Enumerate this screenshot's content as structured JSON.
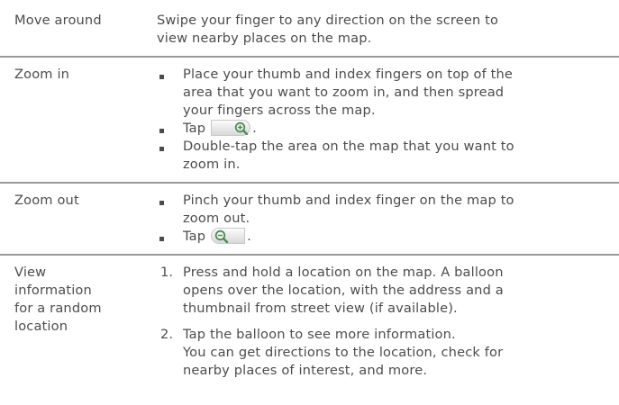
{
  "rows": {
    "move": {
      "label": "Move around",
      "desc": [
        "Swipe your finger to any direction on the screen to",
        "view nearby places on the map."
      ]
    },
    "zoom_in": {
      "label": "Zoom in",
      "bullets": [
        [
          "Place your thumb and index fingers on top of the",
          "area that you want to zoom in, and then spread",
          "your fingers across the map."
        ],
        {
          "before": "Tap",
          "icon": "zoom-in-magnifier-icon",
          "after": "."
        },
        [
          "Double-tap the area on the map that you want to",
          "zoom in."
        ]
      ]
    },
    "zoom_out": {
      "label": "Zoom out",
      "bullets": [
        [
          "Pinch your thumb and index finger on the map to",
          "zoom out."
        ],
        {
          "before": "Tap",
          "icon": "zoom-out-magnifier-icon",
          "after": "."
        }
      ]
    },
    "view_info": {
      "label": [
        "View",
        "information",
        "for a random",
        "location"
      ],
      "steps": [
        {
          "num": "1.",
          "lines": [
            "Press and hold a location on the map. A balloon",
            "opens over the location, with the address and a",
            "thumbnail from street view (if available)."
          ]
        },
        {
          "num": "2.",
          "lines": [
            "Tap the balloon to see more information.",
            "You can get directions to the location, check for",
            "nearby places of interest, and more."
          ]
        }
      ]
    }
  }
}
